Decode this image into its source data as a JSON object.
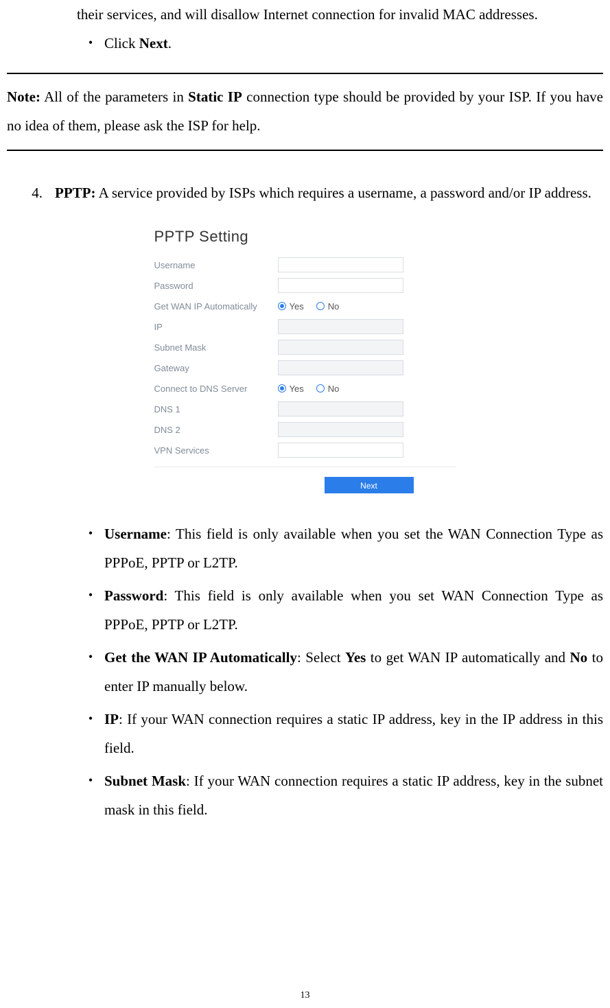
{
  "top": {
    "continued_text": "their services, and will disallow Internet connection for invalid MAC addresses.",
    "click_next_prefix": "Click ",
    "click_next_bold": "Next",
    "click_next_suffix": "."
  },
  "note": {
    "note_label": "Note:",
    "part1": " All of the parameters in ",
    "static_ip": "Static IP",
    "part2": " connection type should be provided by your ISP. If you have no idea of them, please ask the ISP for help."
  },
  "item4": {
    "number": "4.",
    "pptp_label": "PPTP:",
    "desc": " A service provided by ISPs which requires a username, a password and/or IP address."
  },
  "figure": {
    "title": "PPTP Setting",
    "labels": {
      "username": "Username",
      "password": "Password",
      "get_wan": "Get WAN IP Automatically",
      "ip": "IP",
      "subnet": "Subnet Mask",
      "gateway": "Gateway",
      "dns_connect": "Connect to DNS Server",
      "dns1": "DNS 1",
      "dns2": "DNS 2",
      "vpn": "VPN Services"
    },
    "radio_yes": "Yes",
    "radio_no": "No",
    "next_button": "Next"
  },
  "bullets": {
    "username_b": "Username",
    "username_rest": ": This field is only available when you set the WAN Connection Type as PPPoE, PPTP or L2TP.",
    "password_b": "Password",
    "password_rest": ": This field is only available when you set WAN Connection Type as PPPoE, PPTP or L2TP.",
    "getwan_b": "Get the WAN IP Automatically",
    "getwan_mid1": ": Select ",
    "getwan_yes": "Yes",
    "getwan_mid2": " to get WAN IP automatically and ",
    "getwan_no": "No",
    "getwan_mid3": " to enter IP manually below.",
    "ip_b": "IP",
    "ip_rest": ": If your WAN connection requires a static IP address, key in the IP address in this field.",
    "subnet_b": "Subnet Mask",
    "subnet_rest": ": If your WAN connection requires a static IP address, key in the subnet mask in this field."
  },
  "page_number": "13"
}
